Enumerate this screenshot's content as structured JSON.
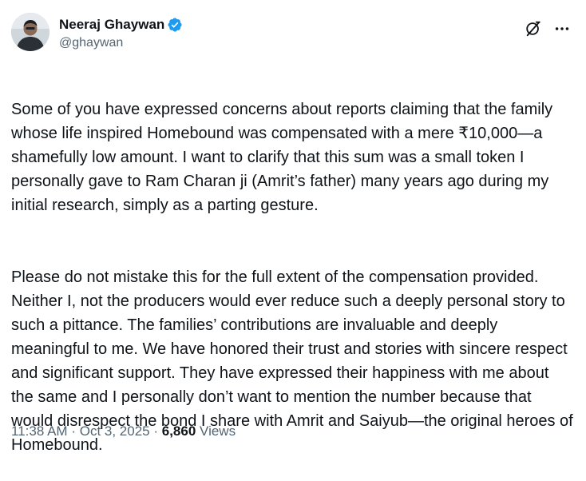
{
  "author": {
    "name": "Neeraj Ghaywan",
    "handle": "@ghaywan",
    "verified": true,
    "verified_color": "#1d9bf0"
  },
  "header_actions": {
    "grok_icon": "grok-icon",
    "more_icon": "more-icon"
  },
  "tweet": {
    "paragraphs": [
      "Some of you have expressed concerns about reports claiming that the family whose life inspired Homebound was compensated with a mere ₹10,000—a shamefully low amount. I want to clarify that this sum was a small token I personally gave to Ram Charan ji (Amrit’s father) many years ago during my initial research, simply as a parting gesture.",
      "Please do not mistake this for the full extent of the compensation provided. Neither I, not the producers would ever reduce such a deeply personal story to such a pittance. The families’ contributions are invaluable and deeply meaningful to me. We have honored their trust and stories with sincere respect and significant support. They have expressed their happiness with me about the same and I personally don’t want to mention the number because that would disrespect the bond I share with Amrit and Saiyub—the original heroes of Homebound."
    ]
  },
  "meta": {
    "time": "11:38 AM",
    "separator": "·",
    "date": "Oct 3, 2025",
    "views_count": "6,860",
    "views_label": "Views"
  },
  "colors": {
    "text": "#0f1419",
    "secondary": "#536471",
    "background": "#ffffff"
  }
}
